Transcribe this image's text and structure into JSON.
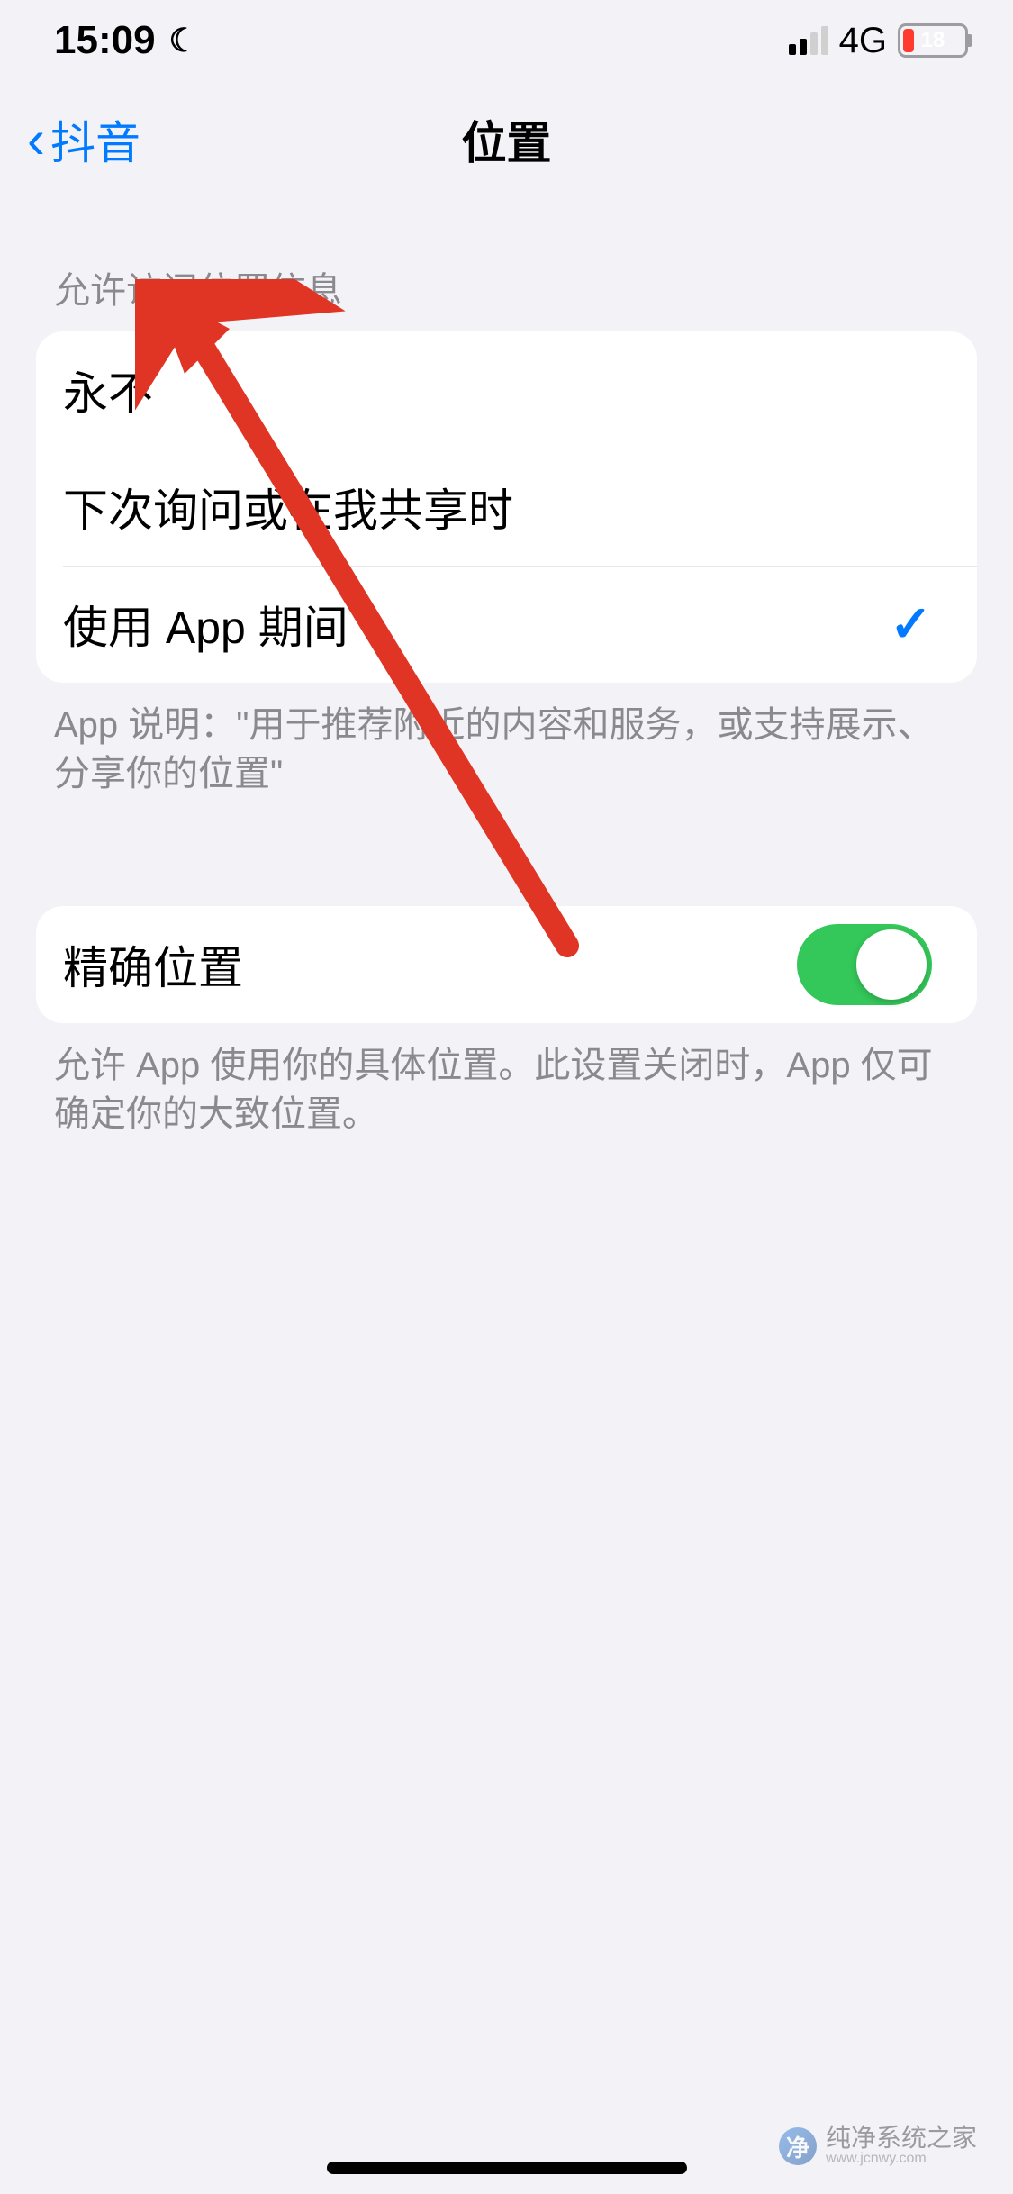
{
  "status_bar": {
    "time": "15:09",
    "network": "4G",
    "battery_percent": "18"
  },
  "nav": {
    "back_label": "抖音",
    "title": "位置"
  },
  "sections": {
    "allow_header": "允许访问位置信息",
    "options": [
      {
        "label": "永不",
        "selected": false
      },
      {
        "label": "下次询问或在我共享时",
        "selected": false
      },
      {
        "label": "使用 App 期间",
        "selected": true
      }
    ],
    "app_explanation": "App 说明：\"用于推荐附近的内容和服务，或支持展示、分享你的位置\"",
    "precise": {
      "label": "精确位置",
      "on": true
    },
    "precise_footer": "允许 App 使用你的具体位置。此设置关闭时，App 仅可确定你的大致位置。"
  },
  "watermark": {
    "text": "纯净系统之家",
    "url": "www.jcnwy.com"
  }
}
